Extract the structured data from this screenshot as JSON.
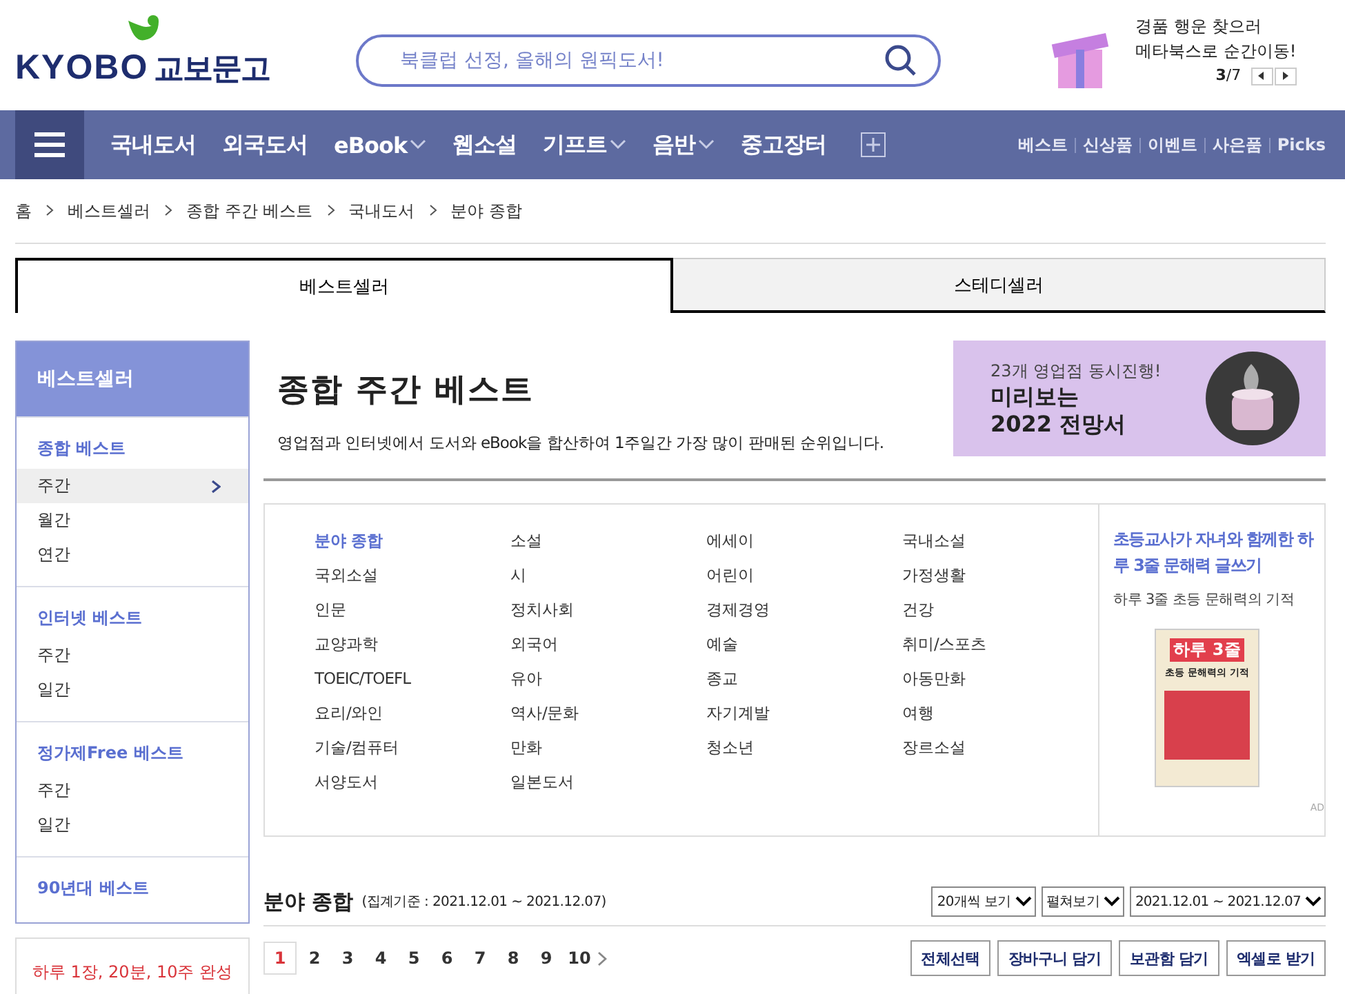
{
  "header": {
    "logo_text": "KYOBO",
    "logo_korean": "교보문고",
    "search": {
      "placeholder": "북클럽 선정, 올해의 원픽도서!"
    },
    "promo": {
      "line_1": "경품 행운 찾으러",
      "line_2": "메타북스로 순간이동!",
      "page_current": "3",
      "page_total": "/7"
    }
  },
  "nav": {
    "items": [
      {
        "label": "국내도서",
        "dropdown": false
      },
      {
        "label": "외국도서",
        "dropdown": false
      },
      {
        "label": "eBook",
        "dropdown": true
      },
      {
        "label": "웹소설",
        "dropdown": false
      },
      {
        "label": "기프트",
        "dropdown": true
      },
      {
        "label": "음반",
        "dropdown": true
      },
      {
        "label": "중고장터",
        "dropdown": false
      }
    ],
    "links": [
      "베스트",
      "신상품",
      "이벤트",
      "사은품",
      "Picks"
    ]
  },
  "breadcrumb": [
    "홈",
    "베스트셀러",
    "종합 주간 베스트",
    "국내도서",
    "분야 종합"
  ],
  "tabs": [
    {
      "label": "베스트셀러",
      "selected": true
    },
    {
      "label": "스테디셀러",
      "selected": false
    }
  ],
  "sidebar": {
    "title": "베스트셀러",
    "groups": [
      {
        "heading": "종합 베스트",
        "items": [
          {
            "label": "주간",
            "selected": true
          },
          {
            "label": "월간",
            "selected": false
          },
          {
            "label": "연간",
            "selected": false
          }
        ]
      },
      {
        "heading": "인터넷 베스트",
        "items": [
          {
            "label": "주간",
            "selected": false
          },
          {
            "label": "일간",
            "selected": false
          }
        ]
      },
      {
        "heading": "정가제Free 베스트",
        "items": [
          {
            "label": "주간",
            "selected": false
          },
          {
            "label": "일간",
            "selected": false
          }
        ]
      },
      {
        "heading": "90년대 베스트"
      }
    ],
    "ad_text": "하루 1장, 20분, 10주 완성"
  },
  "page": {
    "title": "종합 주간 베스트",
    "description": "영업점과 인터넷에서 도서와 eBook을 합산하여 1주일간 가장 많이 판매된 순위입니다.",
    "banner": {
      "line_1": "23개 영업점 동시진행!",
      "line_2": "미리보는",
      "line_3": "2022 전망서"
    }
  },
  "categories": [
    {
      "label": "분야 종합",
      "selected": true
    },
    {
      "label": "소설",
      "selected": false
    },
    {
      "label": "에세이",
      "selected": false
    },
    {
      "label": "국내소설",
      "selected": false
    },
    {
      "label": "국외소설",
      "selected": false
    },
    {
      "label": "시",
      "selected": false
    },
    {
      "label": "어린이",
      "selected": false
    },
    {
      "label": "가정생활",
      "selected": false
    },
    {
      "label": "인문",
      "selected": false
    },
    {
      "label": "정치사회",
      "selected": false
    },
    {
      "label": "경제경영",
      "selected": false
    },
    {
      "label": "건강",
      "selected": false
    },
    {
      "label": "교양과학",
      "selected": false
    },
    {
      "label": "외국어",
      "selected": false
    },
    {
      "label": "예술",
      "selected": false
    },
    {
      "label": "취미/스포츠",
      "selected": false
    },
    {
      "label": "TOEIC/TOEFL",
      "selected": false
    },
    {
      "label": "유아",
      "selected": false
    },
    {
      "label": "종교",
      "selected": false
    },
    {
      "label": "아동만화",
      "selected": false
    },
    {
      "label": "요리/와인",
      "selected": false
    },
    {
      "label": "역사/문화",
      "selected": false
    },
    {
      "label": "자기계발",
      "selected": false
    },
    {
      "label": "여행",
      "selected": false
    },
    {
      "label": "기술/컴퓨터",
      "selected": false
    },
    {
      "label": "만화",
      "selected": false
    },
    {
      "label": "청소년",
      "selected": false
    },
    {
      "label": "장르소설",
      "selected": false
    },
    {
      "label": "서양도서",
      "selected": false
    },
    {
      "label": "일본도서",
      "selected": false
    }
  ],
  "book_ad": {
    "title": "초등교사가 자녀와 함께한 하루 3줄 문해력 글쓰기",
    "subtitle": "하루 3줄 초등 문해력의 기적",
    "cover_title": "하루 3줄",
    "cover_subtitle": "초등 문해력의 기적",
    "ad_mark": "AD"
  },
  "list": {
    "title": "분야 종합",
    "period": "(집계기준 : 2021.12.01 ~ 2021.12.07)",
    "selects": [
      "20개씩 보기",
      "펼쳐보기",
      "2021.12.01 ~ 2021.12.07"
    ],
    "pages": [
      {
        "label": "1",
        "selected": true
      },
      {
        "label": "2",
        "selected": false
      },
      {
        "label": "3",
        "selected": false
      },
      {
        "label": "4",
        "selected": false
      },
      {
        "label": "5",
        "selected": false
      },
      {
        "label": "6",
        "selected": false
      },
      {
        "label": "7",
        "selected": false
      },
      {
        "label": "8",
        "selected": false
      },
      {
        "label": "9",
        "selected": false
      },
      {
        "label": "10",
        "selected": false
      }
    ],
    "buttons": [
      "전체선택",
      "장바구니 담기",
      "보관함 담기",
      "엑셀로 받기"
    ]
  }
}
